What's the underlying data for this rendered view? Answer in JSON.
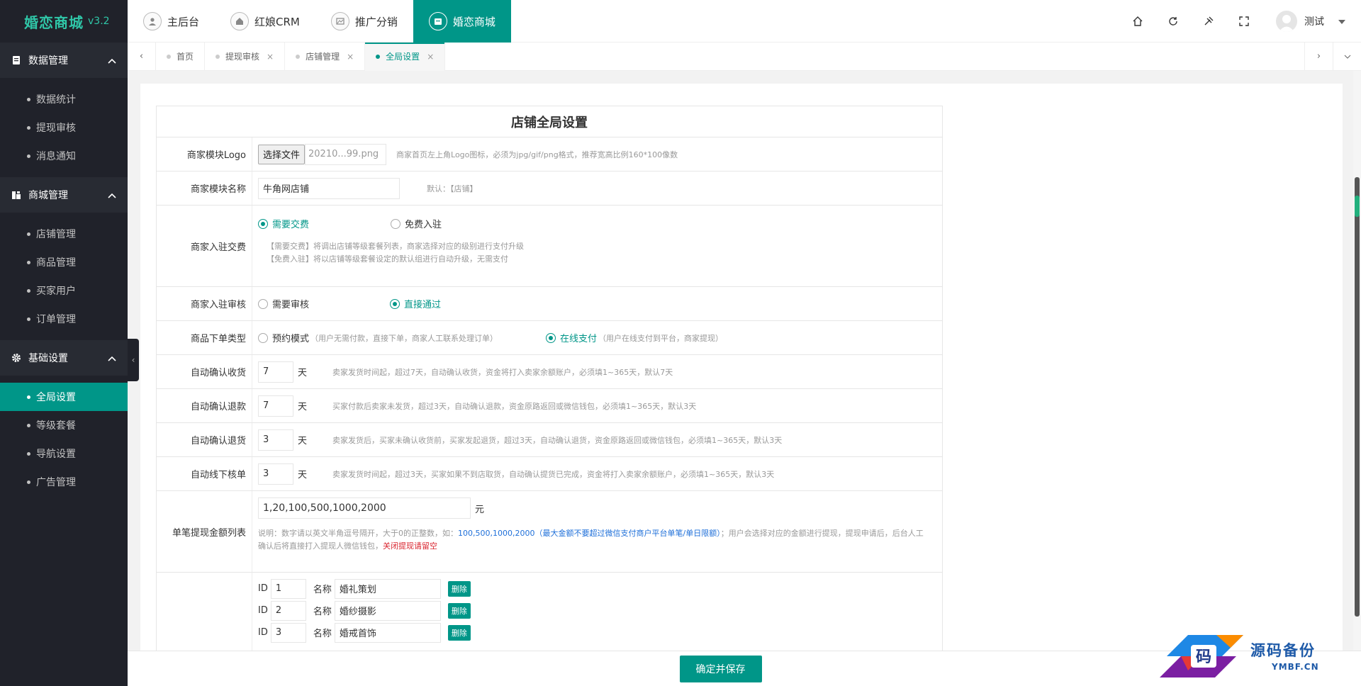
{
  "brand": {
    "name": "婚恋商城",
    "version": "v3.2"
  },
  "top_tabs": [
    {
      "label": "主后台",
      "icon": "user-icon"
    },
    {
      "label": "红娘CRM",
      "icon": "home-icon"
    },
    {
      "label": "推广分销",
      "icon": "image-icon"
    },
    {
      "label": "婚恋商城",
      "icon": "shop-icon",
      "active": true
    }
  ],
  "user": {
    "name": "测试"
  },
  "page_tabs": [
    {
      "label": "首页"
    },
    {
      "label": "提现审核",
      "close": "×"
    },
    {
      "label": "店铺管理",
      "close": "×"
    },
    {
      "label": "全局设置",
      "close": "×",
      "active": true
    }
  ],
  "sidebar": {
    "groups": [
      {
        "title": "数据管理",
        "icon": "document-icon",
        "items": [
          "数据统计",
          "提现审核",
          "消息通知"
        ]
      },
      {
        "title": "商城管理",
        "icon": "store-icon",
        "items": [
          "店铺管理",
          "商品管理",
          "买家用户",
          "订单管理"
        ]
      },
      {
        "title": "基础设置",
        "icon": "gear-icon",
        "items": [
          "全局设置",
          "等级套餐",
          "导航设置",
          "广告管理"
        ]
      }
    ]
  },
  "form": {
    "title": "店铺全局设置",
    "logo": {
      "label": "商家模块Logo",
      "button": "选择文件",
      "file": "20210...99.png",
      "hint": "商家首页左上角Logo图标，必须为jpg/gif/png格式，推荐宽高比例160*100像数"
    },
    "name": {
      "label": "商家模块名称",
      "value": "牛角网店铺",
      "hint": "默认：【店铺】"
    },
    "fee": {
      "label": "商家入驻交费",
      "opt1": "需要交费",
      "opt2": "免费入驻",
      "hint1": "【需要交费】将调出店铺等级套餐列表，商家选择对应的级别进行支付升级",
      "hint2": "【免费入驻】将以店铺等级套餐设定的默认组进行自动升级，无需支付"
    },
    "audit": {
      "label": "商家入驻审核",
      "opt1": "需要审核",
      "opt2": "直接通过"
    },
    "order_type": {
      "label": "商品下单类型",
      "opt1": "预约模式",
      "opt1_sub": "（用户无需付款，直接下单，商家人工联系处理订单）",
      "opt2": "在线支付",
      "opt2_sub": "（用户在线支付到平台，商家提现）"
    },
    "auto_receive": {
      "label": "自动确认收货",
      "value": "7",
      "unit": "天",
      "hint": "卖家发货时间起，超过7天，自动确认收货，资金将打入卖家余额账户，必须填1~365天，默认7天"
    },
    "auto_refund": {
      "label": "自动确认退款",
      "value": "7",
      "unit": "天",
      "hint": "买家付款后卖家未发货，超过3天，自动确认退款，资金原路返回或微信钱包，必须填1~365天，默认3天"
    },
    "auto_return": {
      "label": "自动确认退货",
      "value": "3",
      "unit": "天",
      "hint": "卖家发货后，买家未确认收货前，买家发起退货，超过3天，自动确认退货，资金原路返回或微信钱包，必须填1~365天，默认3天"
    },
    "auto_offline": {
      "label": "自动线下核单",
      "value": "3",
      "unit": "天",
      "hint": "卖家发货时间起，超过3天，买家如果不到店取货，自动确认提货已完成，资金将打入卖家余额账户，必须填1~365天，默认3天"
    },
    "withdraw": {
      "label": "单笔提现金额列表",
      "value": "1,20,100,500,1000,2000",
      "unit": "元",
      "note_a": "说明：数字请以英文半角逗号隔开，大于0的正整数，如：",
      "note_b": "100,500,1000,2000",
      "note_c": "（最大金额不要超过微信支付商户平台单笔/单日限额）",
      "note_d": "；用户会选择对应的金额进行提现，提现申请后，后台人工确认后将直接打入提现人微信钱包，",
      "note_e": "关闭提现请留空"
    },
    "nav": {
      "id_label": "ID",
      "name_label": "名称",
      "delete": "删除",
      "items": [
        {
          "id": "1",
          "name": "婚礼策划"
        },
        {
          "id": "2",
          "name": "婚纱摄影"
        },
        {
          "id": "3",
          "name": "婚戒首饰"
        }
      ]
    }
  },
  "save_button": "确定并保存",
  "watermark": {
    "line1": "源码备份",
    "line2": "YMBF.CN",
    "badge": "码"
  },
  "colors": {
    "primary": "#009688",
    "sidebar": "#20222a",
    "accent_brand": "#2fc7a8"
  }
}
